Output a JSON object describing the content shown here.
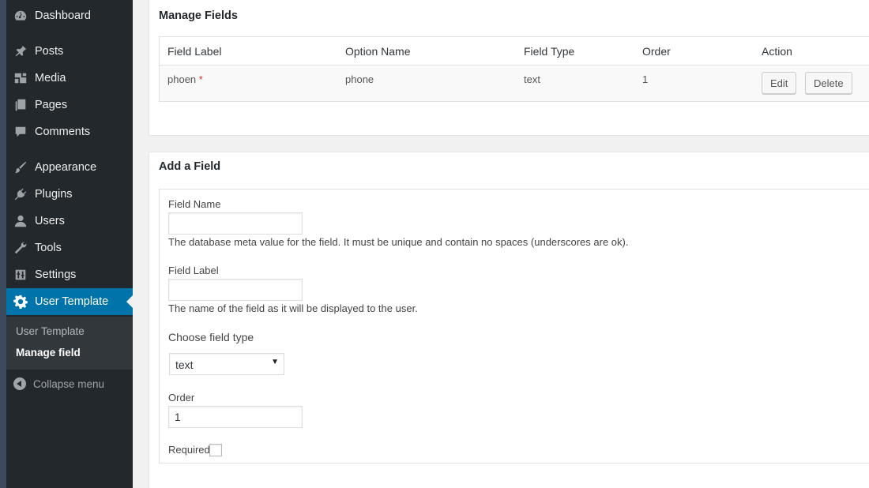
{
  "sidebar": {
    "items": [
      {
        "label": "Dashboard",
        "icon": "dashboard-icon"
      },
      {
        "label": "Posts",
        "icon": "pin-icon"
      },
      {
        "label": "Media",
        "icon": "media-icon"
      },
      {
        "label": "Pages",
        "icon": "pages-icon"
      },
      {
        "label": "Comments",
        "icon": "comment-icon"
      },
      {
        "label": "Appearance",
        "icon": "brush-icon"
      },
      {
        "label": "Plugins",
        "icon": "plugin-icon"
      },
      {
        "label": "Users",
        "icon": "user-icon"
      },
      {
        "label": "Tools",
        "icon": "wrench-icon"
      },
      {
        "label": "Settings",
        "icon": "settings-icon"
      },
      {
        "label": "User Template",
        "icon": "gear-icon"
      }
    ],
    "submenu": [
      "User Template",
      "Manage field"
    ],
    "collapse_label": "Collapse menu",
    "colors": {
      "background": "#23282d",
      "active": "#0073aa",
      "submenu": "#32373c"
    }
  },
  "manage_fields": {
    "title": "Manage Fields",
    "columns": [
      "Field Label",
      "Option Name",
      "Field Type",
      "Order",
      "Action"
    ],
    "rows": [
      {
        "label": "phoen",
        "required_mark": "*",
        "option_name": "phone",
        "type": "text",
        "order": "1",
        "edit": "Edit",
        "delete": "Delete"
      }
    ]
  },
  "add_field": {
    "title": "Add a Field",
    "field_name_label": "Field Name",
    "field_name_value": "",
    "field_name_desc": "The database meta value for the field. It must be unique and contain no spaces (underscores are ok).",
    "field_label_label": "Field Label",
    "field_label_value": "",
    "field_label_desc": "The name of the field as it will be displayed to the user.",
    "type_label": "Choose field type",
    "type_value": "text",
    "order_label": "Order",
    "order_value": "1",
    "required_label": "Required?",
    "required_checked": false
  }
}
